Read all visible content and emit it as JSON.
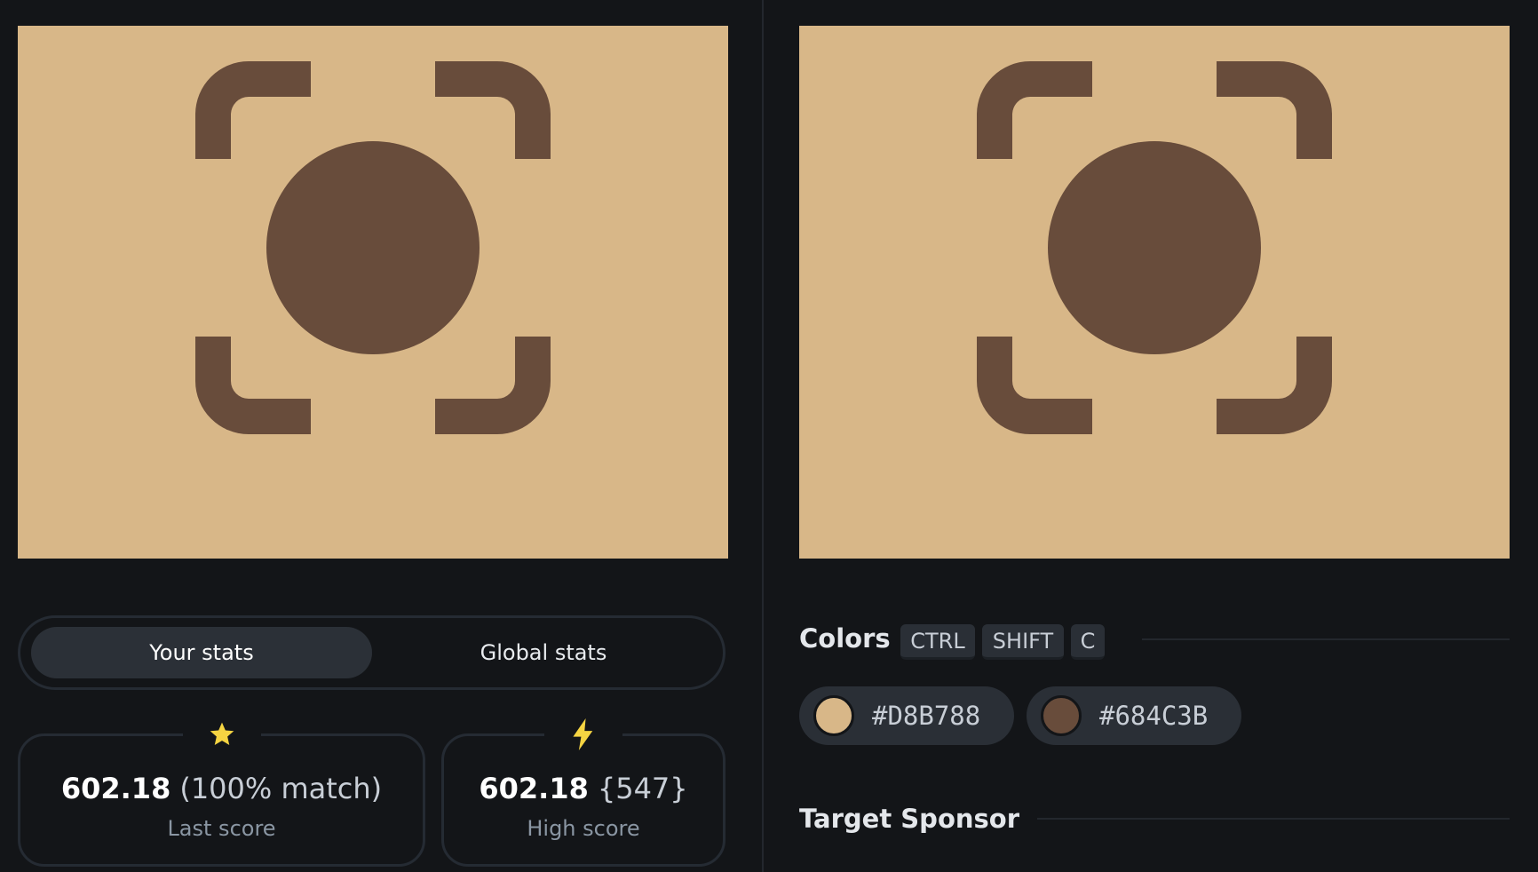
{
  "colors": {
    "background": "#D8B788",
    "foreground": "#684C3B"
  },
  "stats_toggle": {
    "your_stats": "Your stats",
    "global_stats": "Global stats",
    "active": "your_stats"
  },
  "last_score": {
    "icon": "star-icon",
    "value": "602.18",
    "detail": "(100% match)",
    "label": "Last score"
  },
  "high_score": {
    "icon": "lightning-icon",
    "value": "602.18",
    "detail": "{547}",
    "label": "High score"
  },
  "colors_section": {
    "title": "Colors",
    "shortcut": [
      "CTRL",
      "SHIFT",
      "C"
    ],
    "swatches": [
      {
        "hex": "#D8B788",
        "color": "#D8B788"
      },
      {
        "hex": "#684C3B",
        "color": "#684C3B"
      }
    ]
  },
  "sponsor_section": {
    "title": "Target Sponsor"
  }
}
